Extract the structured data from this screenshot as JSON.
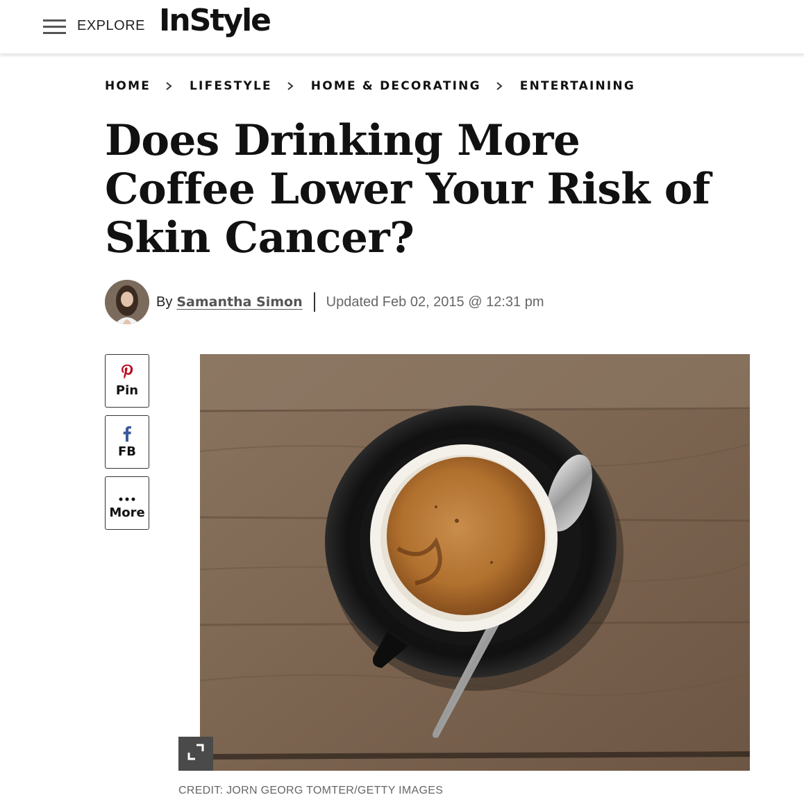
{
  "header": {
    "menu_icon": "hamburger-icon",
    "explore_label": "EXPLORE",
    "logo_text": "InStyle"
  },
  "breadcrumb": {
    "items": [
      "HOME",
      "LIFESTYLE",
      "HOME & DECORATING",
      "ENTERTAINING"
    ],
    "separator_icon": "chevron-right-icon"
  },
  "article": {
    "title": "Does Drinking More Coffee Lower Your Risk of Skin Cancer?",
    "byline_prefix": "By",
    "author": "Samantha Simon",
    "updated": "Updated Feb 02, 2015 @ 12:31 pm"
  },
  "share": {
    "pin_label": "Pin",
    "fb_label": "FB",
    "more_label": "More",
    "pin_icon": "pinterest-icon",
    "fb_icon": "facebook-icon",
    "more_icon": "ellipsis-icon",
    "pin_color": "#bd081c",
    "fb_color": "#3b5998"
  },
  "image": {
    "credit": "CREDIT: JORN GEORG TOMTER/GETTY IMAGES",
    "expand_icon": "expand-icon"
  }
}
